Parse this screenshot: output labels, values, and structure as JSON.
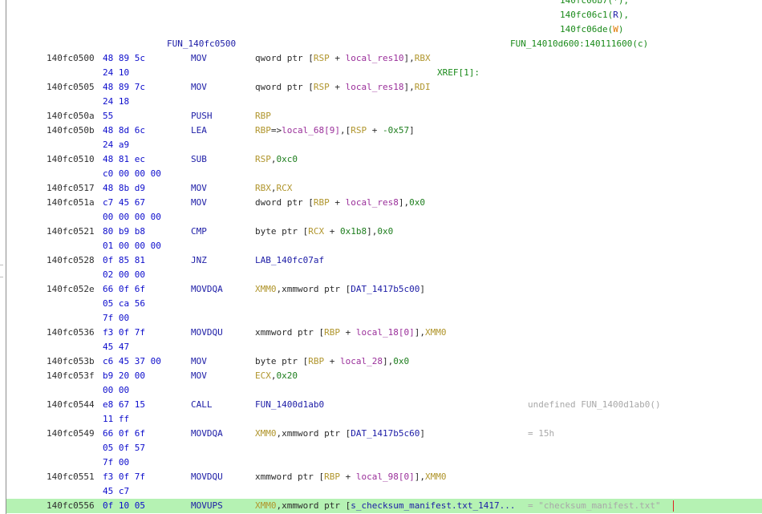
{
  "xrefs_top": [
    {
      "addr": "140fc06b7",
      "mode": "*"
    },
    {
      "addr": "140fc06c1",
      "mode": "R"
    },
    {
      "addr": "140fc06de",
      "mode": "W"
    }
  ],
  "function": {
    "name": "FUN_140fc0500",
    "xref_label": "XREF[1]:",
    "xref_target": "FUN_14010d600:140111600(c)"
  },
  "rows": [
    {
      "addr": "140fc0500",
      "bytes": "48 89 5c",
      "mnemonic": "MOV",
      "ops": [
        [
          "t",
          "qword ptr ["
        ],
        [
          "reg",
          "RSP"
        ],
        [
          "t",
          " + "
        ],
        [
          "var",
          "local_res10"
        ],
        [
          "t",
          "],"
        ],
        [
          "reg",
          "RBX"
        ]
      ]
    },
    {
      "addr": "",
      "bytes": "24 10"
    },
    {
      "addr": "140fc0505",
      "bytes": "48 89 7c",
      "mnemonic": "MOV",
      "ops": [
        [
          "t",
          "qword ptr ["
        ],
        [
          "reg",
          "RSP"
        ],
        [
          "t",
          " + "
        ],
        [
          "var",
          "local_res18"
        ],
        [
          "t",
          "],"
        ],
        [
          "reg",
          "RDI"
        ]
      ]
    },
    {
      "addr": "",
      "bytes": "24 18"
    },
    {
      "addr": "140fc050a",
      "bytes": "55",
      "mnemonic": "PUSH",
      "ops": [
        [
          "reg",
          "RBP"
        ]
      ]
    },
    {
      "addr": "140fc050b",
      "bytes": "48 8d 6c",
      "mnemonic": "LEA",
      "ops": [
        [
          "reg",
          "RBP"
        ],
        [
          "t",
          "=>"
        ],
        [
          "var",
          "local_68[9]"
        ],
        [
          "t",
          ",["
        ],
        [
          "reg",
          "RSP"
        ],
        [
          "t",
          " + "
        ],
        [
          "num",
          "-0x57"
        ],
        [
          "t",
          "]"
        ]
      ]
    },
    {
      "addr": "",
      "bytes": "24 a9"
    },
    {
      "addr": "140fc0510",
      "bytes": "48 81 ec",
      "mnemonic": "SUB",
      "ops": [
        [
          "reg",
          "RSP"
        ],
        [
          "t",
          ","
        ],
        [
          "num",
          "0xc0"
        ]
      ]
    },
    {
      "addr": "",
      "bytes": "c0 00 00 00"
    },
    {
      "addr": "140fc0517",
      "bytes": "48 8b d9",
      "mnemonic": "MOV",
      "ops": [
        [
          "reg",
          "RBX"
        ],
        [
          "t",
          ","
        ],
        [
          "reg",
          "RCX"
        ]
      ]
    },
    {
      "addr": "140fc051a",
      "bytes": "c7 45 67",
      "mnemonic": "MOV",
      "ops": [
        [
          "t",
          "dword ptr ["
        ],
        [
          "reg",
          "RBP"
        ],
        [
          "t",
          " + "
        ],
        [
          "var",
          "local_res8"
        ],
        [
          "t",
          "],"
        ],
        [
          "num",
          "0x0"
        ]
      ]
    },
    {
      "addr": "",
      "bytes": "00 00 00 00"
    },
    {
      "addr": "140fc0521",
      "bytes": "80 b9 b8",
      "mnemonic": "CMP",
      "ops": [
        [
          "t",
          "byte ptr ["
        ],
        [
          "reg",
          "RCX"
        ],
        [
          "t",
          " + "
        ],
        [
          "num",
          "0x1b8"
        ],
        [
          "t",
          "],"
        ],
        [
          "num",
          "0x0"
        ]
      ]
    },
    {
      "addr": "",
      "bytes": "01 00 00 00"
    },
    {
      "addr": "140fc0528",
      "bytes": "0f 85 81",
      "mnemonic": "JNZ",
      "ops": [
        [
          "lab",
          "LAB_140fc07af"
        ]
      ]
    },
    {
      "addr": "",
      "bytes": "02 00 00"
    },
    {
      "addr": "140fc052e",
      "bytes": "66 0f 6f",
      "mnemonic": "MOVDQA",
      "ops": [
        [
          "reg",
          "XMM0"
        ],
        [
          "t",
          ",xmmword ptr ["
        ],
        [
          "lab",
          "DAT_1417b5c00"
        ],
        [
          "t",
          "]"
        ]
      ]
    },
    {
      "addr": "",
      "bytes": "05 ca 56"
    },
    {
      "addr": "",
      "bytes": "7f 00"
    },
    {
      "addr": "140fc0536",
      "bytes": "f3 0f 7f",
      "mnemonic": "MOVDQU",
      "ops": [
        [
          "t",
          "xmmword ptr ["
        ],
        [
          "reg",
          "RBP"
        ],
        [
          "t",
          " + "
        ],
        [
          "var",
          "local_18[0]"
        ],
        [
          "t",
          "],"
        ],
        [
          "reg",
          "XMM0"
        ]
      ]
    },
    {
      "addr": "",
      "bytes": "45 47"
    },
    {
      "addr": "140fc053b",
      "bytes": "c6 45 37 00",
      "mnemonic": "MOV",
      "ops": [
        [
          "t",
          "byte ptr ["
        ],
        [
          "reg",
          "RBP"
        ],
        [
          "t",
          " + "
        ],
        [
          "var",
          "local_28"
        ],
        [
          "t",
          "],"
        ],
        [
          "num",
          "0x0"
        ]
      ]
    },
    {
      "addr": "140fc053f",
      "bytes": "b9 20 00",
      "mnemonic": "MOV",
      "ops": [
        [
          "reg",
          "ECX"
        ],
        [
          "t",
          ","
        ],
        [
          "num",
          "0x20"
        ]
      ]
    },
    {
      "addr": "",
      "bytes": "00 00"
    },
    {
      "addr": "140fc0544",
      "bytes": "e8 67 15",
      "mnemonic": "CALL",
      "ops": [
        [
          "lab",
          "FUN_1400d1ab0"
        ]
      ],
      "comment": "undefined FUN_1400d1ab0()"
    },
    {
      "addr": "",
      "bytes": "11 ff"
    },
    {
      "addr": "140fc0549",
      "bytes": "66 0f 6f",
      "mnemonic": "MOVDQA",
      "ops": [
        [
          "reg",
          "XMM0"
        ],
        [
          "t",
          ",xmmword ptr ["
        ],
        [
          "lab",
          "DAT_1417b5c60"
        ],
        [
          "t",
          "]"
        ]
      ],
      "comment": "= 15h"
    },
    {
      "addr": "",
      "bytes": "05 0f 57"
    },
    {
      "addr": "",
      "bytes": "7f 00"
    },
    {
      "addr": "140fc0551",
      "bytes": "f3 0f 7f",
      "mnemonic": "MOVDQU",
      "ops": [
        [
          "t",
          "xmmword ptr ["
        ],
        [
          "reg",
          "RBP"
        ],
        [
          "t",
          " + "
        ],
        [
          "var",
          "local_98[0]"
        ],
        [
          "t",
          "],"
        ],
        [
          "reg",
          "XMM0"
        ]
      ]
    },
    {
      "addr": "",
      "bytes": "45 c7"
    },
    {
      "addr": "140fc0556",
      "bytes": "0f 10 05",
      "mnemonic": "MOVUPS",
      "ops": [
        [
          "reg",
          "XMM0"
        ],
        [
          "t",
          ",xmmword ptr ["
        ],
        [
          "lab",
          "s_checksum_manifest.txt_1417..."
        ]
      ],
      "comment": "= \"checksum_manifest.txt\"",
      "highlight": true
    }
  ]
}
